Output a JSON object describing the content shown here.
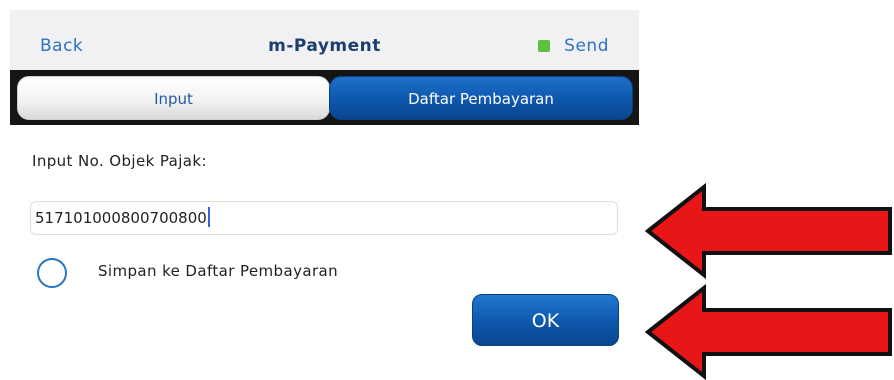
{
  "header": {
    "back_label": "Back",
    "title": "m-Payment",
    "send_label": "Send"
  },
  "tabs": [
    {
      "label": "Input",
      "active": false
    },
    {
      "label": "Daftar Pembayaran",
      "active": true
    }
  ],
  "form": {
    "field_label": "Input No. Objek Pajak:",
    "field_value": "517101000800700800",
    "save_option_label": "Simpan ke Daftar Pembayaran",
    "save_option_checked": false,
    "ok_label": "OK"
  },
  "annotations": [
    {
      "icon": "arrow-left-icon",
      "color": "#e81616",
      "points_to": "tax-object-number-input"
    },
    {
      "icon": "arrow-left-icon",
      "color": "#e81616",
      "points_to": "ok-button"
    }
  ],
  "colors": {
    "accent": "#2a74c2",
    "title": "#1d3e6f",
    "send_indicator": "#5fbf3f",
    "active_tab": "#0d57ad",
    "arrow": "#e81616"
  }
}
